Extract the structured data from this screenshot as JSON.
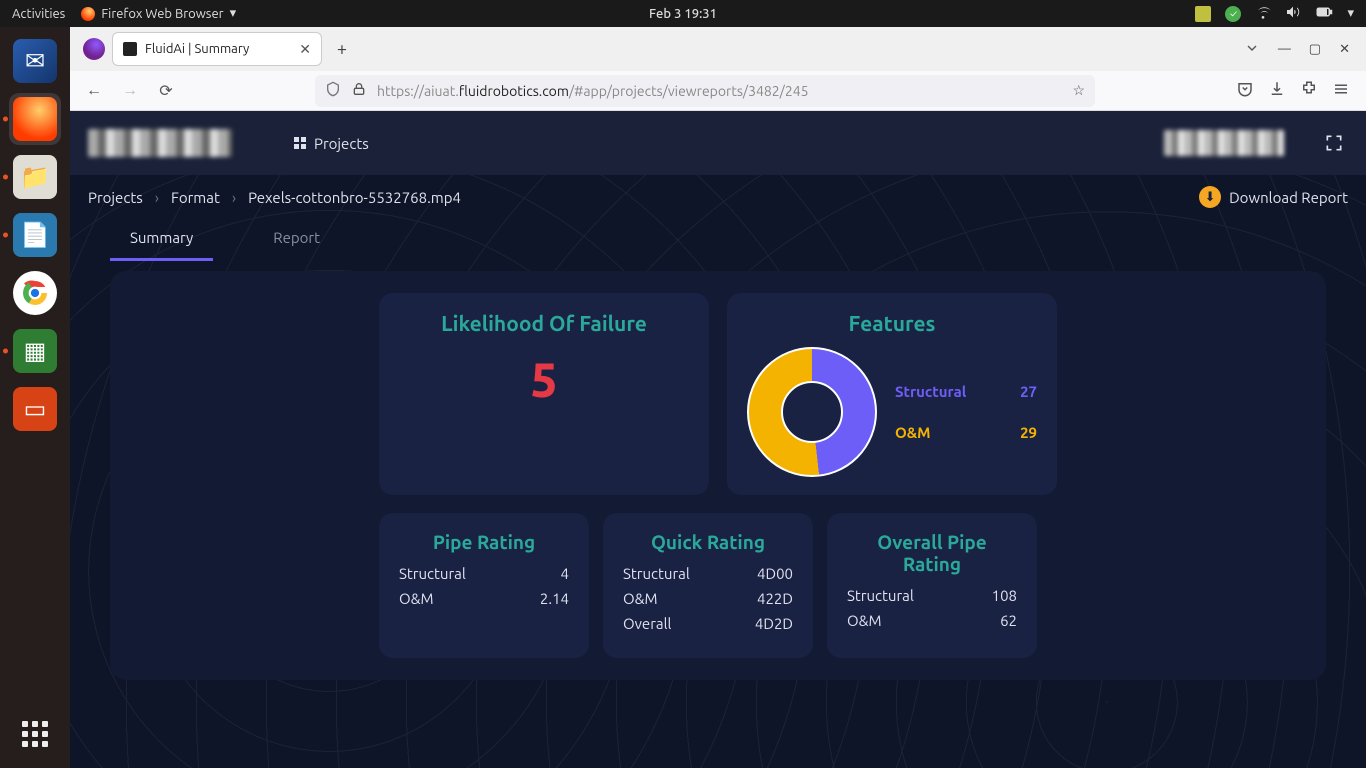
{
  "os": {
    "activities": "Activities",
    "app_indicator": "Firefox Web Browser",
    "clock": "Feb 3  19:31"
  },
  "browser": {
    "tab_title": "FluidAi | Summary",
    "url_prefix": "https://aiuat.",
    "url_host": "fluidrobotics.com",
    "url_path": "/#app/projects/viewreports/3482/245"
  },
  "app": {
    "nav_projects": "Projects",
    "breadcrumbs": {
      "root": "Projects",
      "mid": "Format",
      "leaf": "Pexels-cottonbro-5532768.mp4"
    },
    "download_label": "Download Report",
    "tabs": {
      "summary": "Summary",
      "report": "Report"
    }
  },
  "summary": {
    "likelihood_title": "Likelihood Of Failure",
    "likelihood_value": "5",
    "features_title": "Features",
    "features": {
      "structural_label": "Structural",
      "structural_count": "27",
      "om_label": "O&M",
      "om_count": "29"
    },
    "pipe_rating": {
      "title": "Pipe Rating",
      "structural_label": "Structural",
      "structural_value": "4",
      "om_label": "O&M",
      "om_value": "2.14"
    },
    "quick_rating": {
      "title": "Quick Rating",
      "structural_label": "Structural",
      "structural_value": "4D00",
      "om_label": "O&M",
      "om_value": "422D",
      "overall_label": "Overall",
      "overall_value": "4D2D"
    },
    "overall_rating": {
      "title": "Overall Pipe Rating",
      "structural_label": "Structural",
      "structural_value": "108",
      "om_label": "O&M",
      "om_value": "62"
    }
  },
  "chart_data": {
    "type": "pie",
    "title": "Features",
    "series": [
      {
        "name": "Structural",
        "value": 27,
        "color": "#6d5ef7"
      },
      {
        "name": "O&M",
        "value": 29,
        "color": "#f5b301"
      }
    ]
  }
}
